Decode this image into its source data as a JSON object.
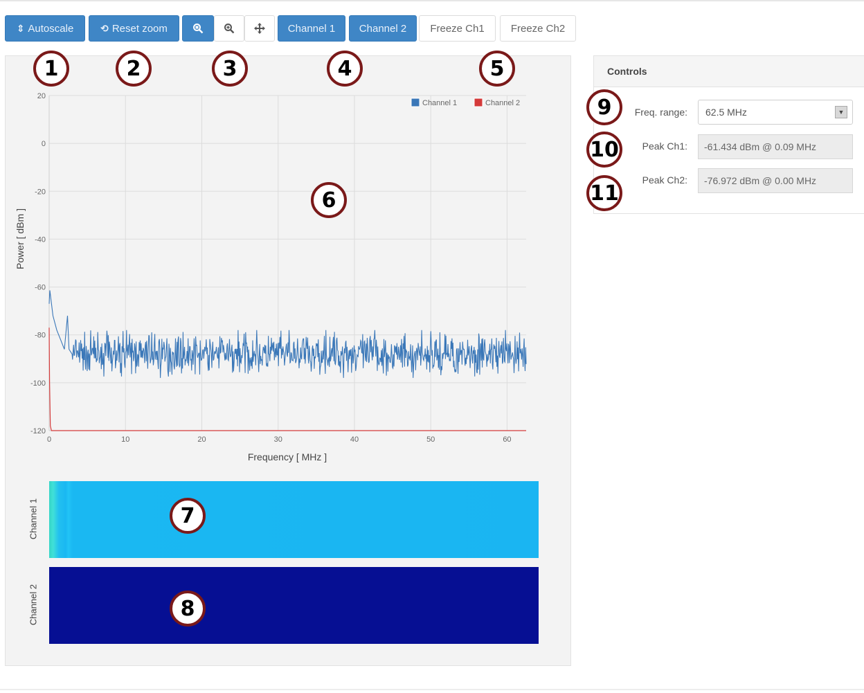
{
  "toolbar": {
    "autoscale": {
      "icon": "autoscale-arrow-icon",
      "glyph": "⇕",
      "label": "Autoscale"
    },
    "reset_zoom": {
      "icon": "reset-zoom-icon",
      "glyph": "⟲",
      "label": "Reset zoom"
    },
    "zoom_box": {
      "icon": "zoom-box-icon",
      "glyph": "🔍"
    },
    "zoom_in": {
      "icon": "zoom-in-icon",
      "glyph": "⊕"
    },
    "pan": {
      "icon": "pan-icon",
      "glyph": "✥"
    },
    "channel1": "Channel 1",
    "channel2": "Channel 2",
    "freeze_ch1": "Freeze Ch1",
    "freeze_ch2": "Freeze Ch2"
  },
  "markers": [
    "1",
    "2",
    "3",
    "4",
    "5",
    "6",
    "7",
    "8",
    "9",
    "10",
    "11"
  ],
  "colors": {
    "channel1": "#3a77b8",
    "channel2": "#d43a3a",
    "primary_button": "#3f86c6",
    "marker_border": "#7a1919",
    "waterfall_ch1": "#1ab5f2",
    "waterfall_ch2": "#060f93"
  },
  "chart_data": {
    "type": "line",
    "xlabel": "Frequency [ MHz ]",
    "ylabel": "Power [ dBm ]",
    "xlim": [
      0,
      62.5
    ],
    "ylim": [
      -120,
      20
    ],
    "x_ticks": [
      "0",
      "10",
      "20",
      "30",
      "40",
      "50",
      "60"
    ],
    "y_ticks": [
      "20",
      "0",
      "-20",
      "-40",
      "-60",
      "-80",
      "-100",
      "-120"
    ],
    "grid": true,
    "legend_position": "top-right",
    "series": [
      {
        "name": "Channel 1",
        "color": "#3a77b8",
        "noise_floor_dbm": -88,
        "noise_range_dbm": [
          -98,
          -78
        ],
        "x": [
          0,
          0.09,
          0.5,
          1,
          1.5,
          2,
          2.4,
          2.6,
          3,
          62.5
        ],
        "values": [
          -67,
          -61.4,
          -72,
          -78,
          -82,
          -86,
          -72,
          -86,
          -88,
          -88
        ]
      },
      {
        "name": "Channel 2",
        "color": "#d43a3a",
        "x": [
          0,
          0.05,
          0.15,
          0.3,
          62.5
        ],
        "values": [
          -76.972,
          -100,
          -118,
          -120,
          -120
        ]
      }
    ]
  },
  "waterfalls": [
    {
      "label": "Channel 1"
    },
    {
      "label": "Channel 2"
    }
  ],
  "controls": {
    "title": "Controls",
    "freq_range_label": "Freq. range:",
    "freq_range_value": "62.5 MHz",
    "peak_ch1_label": "Peak Ch1:",
    "peak_ch1_value": "-61.434 dBm @ 0.09 MHz",
    "peak_ch2_label": "Peak Ch2:",
    "peak_ch2_value": "-76.972 dBm @ 0.00 MHz"
  }
}
